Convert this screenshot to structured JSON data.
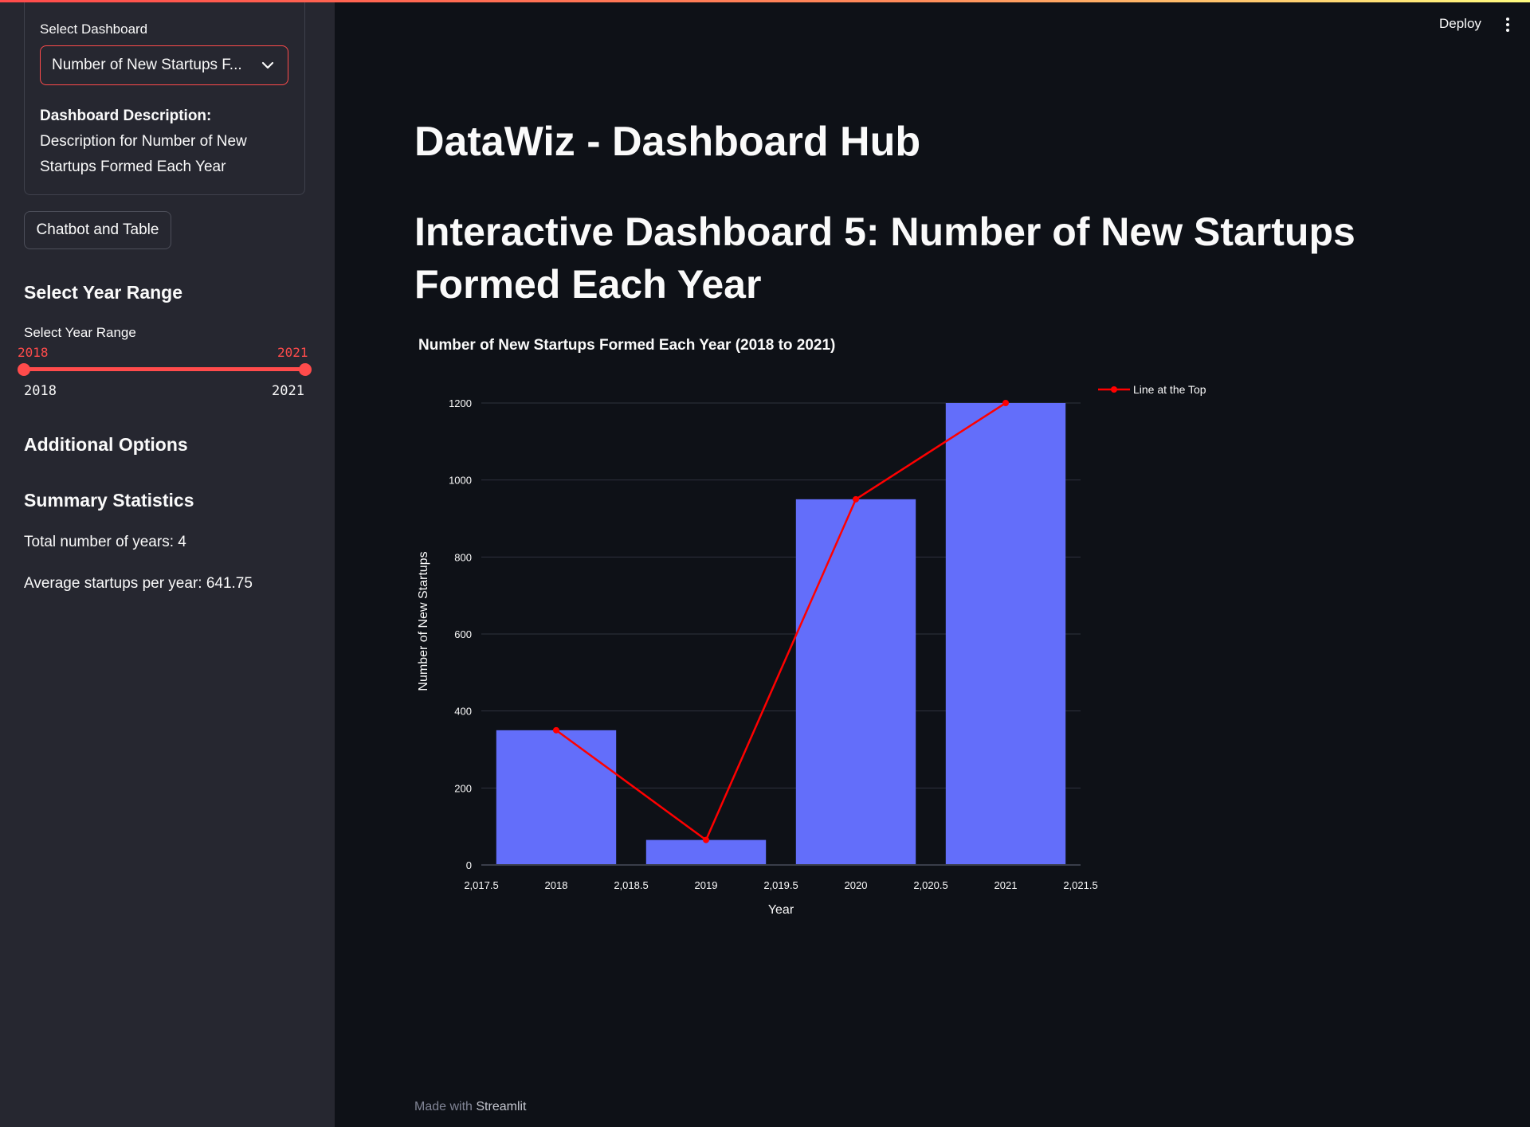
{
  "header": {
    "deploy_label": "Deploy",
    "menu_icon": "kebab-menu-icon"
  },
  "sidebar": {
    "select_label": "Select Dashboard",
    "select_value": "Number of New Startups F...",
    "description_bold": "Dashboard Description:",
    "description_text": " Description for Number of New Startups Formed Each Year",
    "chatbot_button": "Chatbot and Table",
    "year_range_heading": "Select Year Range",
    "year_range_label": "Select Year Range",
    "slider": {
      "min": "2018",
      "max": "2021",
      "low_value": "2018",
      "high_value": "2021"
    },
    "additional_options": "Additional Options",
    "summary_heading": "Summary Statistics",
    "total_years": "Total number of years: 4",
    "avg_startups": "Average startups per year: 641.75"
  },
  "main": {
    "title": "DataWiz - Dashboard Hub",
    "subtitle": "Interactive Dashboard 5: Number of New Startups Formed Each Year"
  },
  "chart_data": {
    "type": "bar",
    "title": "Number of New Startups Formed Each Year (2018 to 2021)",
    "xlabel": "Year",
    "ylabel": "Number of New Startups",
    "x_tick_labels": [
      "2,017.5",
      "2018",
      "2,018.5",
      "2019",
      "2,019.5",
      "2020",
      "2,020.5",
      "2021",
      "2,021.5"
    ],
    "y_tick_labels": [
      "0",
      "200",
      "400",
      "600",
      "800",
      "1000",
      "1200"
    ],
    "xlim": [
      2017.5,
      2021.5
    ],
    "ylim": [
      0,
      1200
    ],
    "categories": [
      2018,
      2019,
      2020,
      2021
    ],
    "values": [
      350,
      65,
      950,
      1200
    ],
    "line_series": {
      "name": "Line at the Top",
      "x": [
        2018,
        2019,
        2020,
        2021
      ],
      "y": [
        350,
        65,
        950,
        1200
      ]
    },
    "bar_color": "#636efa",
    "line_color": "#ff0000",
    "grid": true,
    "legend_placement": "top-right"
  },
  "footer": {
    "made_with": "Made with",
    "brand": "Streamlit"
  }
}
